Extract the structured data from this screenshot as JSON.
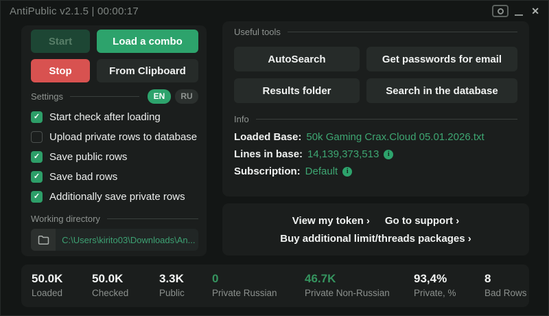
{
  "window": {
    "title": "AntiPublic v2.1.5 | 00:00:17"
  },
  "icons": {
    "check": "✓",
    "close": "✕",
    "info": "i"
  },
  "colors": {
    "accent_green": "#2da36c",
    "danger_red": "#d85250",
    "value_green": "#3ea672"
  },
  "left_panel": {
    "start_button": "Start",
    "load_combo_button": "Load a combo",
    "stop_button": "Stop",
    "from_clipboard_button": "From Clipboard",
    "settings_label": "Settings",
    "language": {
      "en": "EN",
      "ru": "RU",
      "selected": "EN"
    },
    "checkboxes": [
      {
        "label": "Start check after loading",
        "checked": true
      },
      {
        "label": "Upload private rows to database",
        "checked": false
      },
      {
        "label": "Save public rows",
        "checked": true
      },
      {
        "label": "Save bad rows",
        "checked": true
      },
      {
        "label": "Additionally save private rows",
        "checked": true
      }
    ],
    "working_directory": {
      "label": "Working directory",
      "path": "C:\\Users\\kirito03\\Downloads\\An..."
    }
  },
  "useful_tools": {
    "label": "Useful tools",
    "buttons": [
      "AutoSearch",
      "Get passwords for email",
      "Results folder",
      "Search in the database"
    ]
  },
  "info": {
    "label": "Info",
    "rows": [
      {
        "label": "Loaded Base:",
        "value": "50k Gaming Crax.Cloud 05.01.2026.txt",
        "info_icon": false
      },
      {
        "label": "Lines in base:",
        "value": "14,139,373,513",
        "info_icon": true
      },
      {
        "label": "Subscription:",
        "value": "Default",
        "info_icon": true
      }
    ]
  },
  "links": {
    "view_token": "View my token ›",
    "support": "Go to support ›",
    "buy_packages": "Buy additional limit/threads packages ›"
  },
  "stats": {
    "items": [
      {
        "value": "50.0K",
        "label": "Loaded",
        "accent": false
      },
      {
        "value": "50.0K",
        "label": "Checked",
        "accent": false
      },
      {
        "value": "3.3K",
        "label": "Public",
        "accent": false
      },
      {
        "value": "0",
        "label": "Private Russian",
        "accent": true
      },
      {
        "value": "46.7K",
        "label": "Private Non-Russian",
        "accent": true
      },
      {
        "value": "93,4%",
        "label": "Private, %",
        "accent": false
      },
      {
        "value": "8",
        "label": "Bad Rows",
        "accent": false
      }
    ]
  }
}
